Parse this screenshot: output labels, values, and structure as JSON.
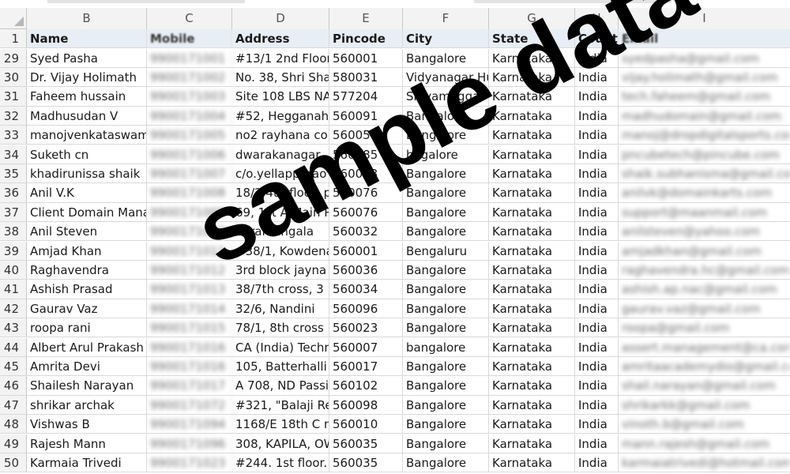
{
  "columns": [
    "B",
    "C",
    "D",
    "E",
    "F",
    "G",
    "H",
    "I"
  ],
  "header_row_number": "1",
  "headers": [
    "Name",
    "Mobile",
    "Address",
    "Pincode",
    "City",
    "State",
    "Countr",
    "Email"
  ],
  "rows": [
    {
      "n": "29",
      "name": "Syed Pasha",
      "mobile": "9900171001",
      "address": "#13/1 2nd Floor",
      "pin": "560001",
      "city": "Bangalore",
      "state": "Karnataka",
      "country": "India",
      "email": "syedpasha@gmail.com"
    },
    {
      "n": "30",
      "name": "Dr. Vijay Holimath",
      "mobile": "9900171002",
      "address": "No. 38, Shri Shar",
      "pin": "580031",
      "city": "Vidyanagar Hu",
      "state": "Karnataka",
      "country": "India",
      "email": "vijay.holimath@gmail.com"
    },
    {
      "n": "31",
      "name": "Faheem hussain",
      "mobile": "9900171003",
      "address": "Site 108 LBS NAG",
      "pin": "577204",
      "city": "Shivamogga",
      "state": "Karnataka",
      "country": "India",
      "email": "tech.faheem@gmail.com"
    },
    {
      "n": "32",
      "name": "Madhusudan V",
      "mobile": "9900171004",
      "address": "#52, Hegganaha",
      "pin": "560091",
      "city": "Bangalore",
      "state": "Karnataka",
      "country": "India",
      "email": "madhudomain@gmail.com"
    },
    {
      "n": "33",
      "name": "manojvenkataswam",
      "mobile": "9900171005",
      "address": "no2 rayhana cor",
      "pin": "560054",
      "city": "Bangalore",
      "state": "Karnataka",
      "country": "India",
      "email": "manoj@dropdigitalsports.com"
    },
    {
      "n": "34",
      "name": "Suketh cn",
      "mobile": "9900171006",
      "address": "dwarakanagar, h",
      "pin": "560085",
      "city": "bagalore",
      "state": "Karnataka",
      "country": "India",
      "email": "pncubetech@pincube.com"
    },
    {
      "n": "35",
      "name": "khadirunissa shaik",
      "mobile": "9900171007",
      "address": "c/o.yellapparao",
      "pin": "560043",
      "city": "Bangalore",
      "state": "Karnataka",
      "country": "India",
      "email": "shaik.subhanisma@gmail.com"
    },
    {
      "n": "36",
      "name": "Anil V.K",
      "mobile": "9900171008",
      "address": "18/2 4th floor, p",
      "pin": "560076",
      "city": "Bangalore",
      "state": "Karnataka",
      "country": "India",
      "email": "anilvk@domainkarts.com"
    },
    {
      "n": "37",
      "name": "Client Domain Mana",
      "mobile": "9900171009",
      "address": "69, 1st A Main R",
      "pin": "560076",
      "city": "Bangalore",
      "state": "Karnataka",
      "country": "India",
      "email": "support@maanmail.com"
    },
    {
      "n": "38",
      "name": "Anil Steven",
      "mobile": "9900171010",
      "address": "Koramangala",
      "pin": "560032",
      "city": "Bangalore",
      "state": "Karnataka",
      "country": "India",
      "email": "anilsteven@yahoo.com"
    },
    {
      "n": "39",
      "name": "Amjad Khan",
      "mobile": "9900171011",
      "address": "#38/1, Kowdena",
      "pin": "560001",
      "city": "Bengaluru",
      "state": "Karnataka",
      "country": "India",
      "email": "amjadkhan@gmail.com"
    },
    {
      "n": "40",
      "name": "Raghavendra",
      "mobile": "9900171012",
      "address": "3rd block jayna",
      "pin": "560036",
      "city": "Bangalore",
      "state": "Karnataka",
      "country": "India",
      "email": "raghavendra.hc@gmail.com"
    },
    {
      "n": "41",
      "name": "Ashish Prasad",
      "mobile": "9900171013",
      "address": "38/7th cross, 3",
      "pin": "560034",
      "city": "Bangalore",
      "state": "Karnataka",
      "country": "India",
      "email": "ashish.ap.nac@gmail.com"
    },
    {
      "n": "42",
      "name": "Gaurav Vaz",
      "mobile": "9900171014",
      "address": "32/6, Nandini",
      "pin": "560096",
      "city": "Bangalore",
      "state": "Karnataka",
      "country": "India",
      "email": "gaurav.vaz@gmail.com"
    },
    {
      "n": "43",
      "name": "roopa rani",
      "mobile": "9900171015",
      "address": "78/1, 8th cross r",
      "pin": "560023",
      "city": "Bangalore",
      "state": "Karnataka",
      "country": "India",
      "email": "roopa@gmail.com"
    },
    {
      "n": "44",
      "name": "Albert Arul Prakash",
      "mobile": "9900171016",
      "address": "CA (India) Techr",
      "pin": "560007",
      "city": "bangalore",
      "state": "Karnataka",
      "country": "India",
      "email": "assert.management@ca.com"
    },
    {
      "n": "45",
      "name": "Amrita Devi",
      "mobile": "9900171016",
      "address": "105, Batterhalli",
      "pin": "560017",
      "city": "Bangalore",
      "state": "Karnataka",
      "country": "India",
      "email": "amritaacademydio@gmail.com"
    },
    {
      "n": "46",
      "name": "Shailesh Narayan",
      "mobile": "9900171017",
      "address": "A 708, ND Passio",
      "pin": "560102",
      "city": "Bangalore",
      "state": "Karnataka",
      "country": "India",
      "email": "shail.narayan@gmail.com"
    },
    {
      "n": "47",
      "name": "shrikar archak",
      "mobile": "9900171072",
      "address": "#321, \"Balaji Res",
      "pin": "560098",
      "city": "Bangalore",
      "state": "Karnataka",
      "country": "India",
      "email": "shrikarkk@gmail.com"
    },
    {
      "n": "48",
      "name": "Vishwas B",
      "mobile": "9900171094",
      "address": "1168/E 18th C m",
      "pin": "560010",
      "city": "Bangalore",
      "state": "Karnataka",
      "country": "India",
      "email": "vinoth.b@gmail.com"
    },
    {
      "n": "49",
      "name": "Rajesh Mann",
      "mobile": "9900171096",
      "address": "308, KAPILA, OW",
      "pin": "560035",
      "city": "Bangalore",
      "state": "Karnataka",
      "country": "India",
      "email": "mann.rajesh@gmail.com"
    },
    {
      "n": "50",
      "name": "Karmaia Trivedi",
      "mobile": "9900171023",
      "address": "#244. 1st floor. L",
      "pin": "560035",
      "city": "Bangalore",
      "state": "Karnataka",
      "country": "India",
      "email": "karmaiatrivedi@hotmail.com"
    }
  ],
  "watermark": "sample data"
}
